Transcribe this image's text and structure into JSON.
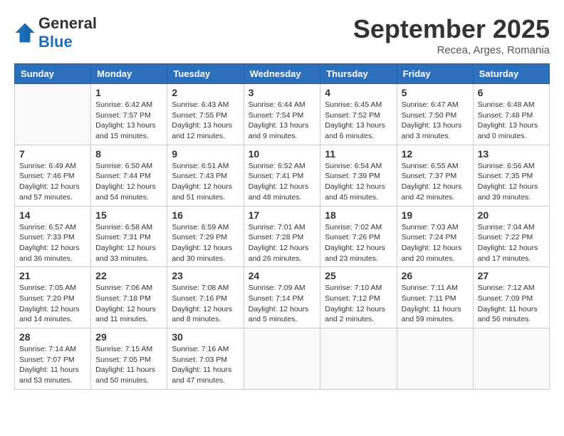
{
  "header": {
    "logo_general": "General",
    "logo_blue": "Blue",
    "month_title": "September 2025",
    "subtitle": "Recea, Arges, Romania"
  },
  "days_of_week": [
    "Sunday",
    "Monday",
    "Tuesday",
    "Wednesday",
    "Thursday",
    "Friday",
    "Saturday"
  ],
  "weeks": [
    [
      {
        "day": "",
        "info": ""
      },
      {
        "day": "1",
        "info": "Sunrise: 6:42 AM\nSunset: 7:57 PM\nDaylight: 13 hours\nand 15 minutes."
      },
      {
        "day": "2",
        "info": "Sunrise: 6:43 AM\nSunset: 7:55 PM\nDaylight: 13 hours\nand 12 minutes."
      },
      {
        "day": "3",
        "info": "Sunrise: 6:44 AM\nSunset: 7:54 PM\nDaylight: 13 hours\nand 9 minutes."
      },
      {
        "day": "4",
        "info": "Sunrise: 6:45 AM\nSunset: 7:52 PM\nDaylight: 13 hours\nand 6 minutes."
      },
      {
        "day": "5",
        "info": "Sunrise: 6:47 AM\nSunset: 7:50 PM\nDaylight: 13 hours\nand 3 minutes."
      },
      {
        "day": "6",
        "info": "Sunrise: 6:48 AM\nSunset: 7:48 PM\nDaylight: 13 hours\nand 0 minutes."
      }
    ],
    [
      {
        "day": "7",
        "info": "Sunrise: 6:49 AM\nSunset: 7:46 PM\nDaylight: 12 hours\nand 57 minutes."
      },
      {
        "day": "8",
        "info": "Sunrise: 6:50 AM\nSunset: 7:44 PM\nDaylight: 12 hours\nand 54 minutes."
      },
      {
        "day": "9",
        "info": "Sunrise: 6:51 AM\nSunset: 7:43 PM\nDaylight: 12 hours\nand 51 minutes."
      },
      {
        "day": "10",
        "info": "Sunrise: 6:52 AM\nSunset: 7:41 PM\nDaylight: 12 hours\nand 48 minutes."
      },
      {
        "day": "11",
        "info": "Sunrise: 6:54 AM\nSunset: 7:39 PM\nDaylight: 12 hours\nand 45 minutes."
      },
      {
        "day": "12",
        "info": "Sunrise: 6:55 AM\nSunset: 7:37 PM\nDaylight: 12 hours\nand 42 minutes."
      },
      {
        "day": "13",
        "info": "Sunrise: 6:56 AM\nSunset: 7:35 PM\nDaylight: 12 hours\nand 39 minutes."
      }
    ],
    [
      {
        "day": "14",
        "info": "Sunrise: 6:57 AM\nSunset: 7:33 PM\nDaylight: 12 hours\nand 36 minutes."
      },
      {
        "day": "15",
        "info": "Sunrise: 6:58 AM\nSunset: 7:31 PM\nDaylight: 12 hours\nand 33 minutes."
      },
      {
        "day": "16",
        "info": "Sunrise: 6:59 AM\nSunset: 7:29 PM\nDaylight: 12 hours\nand 30 minutes."
      },
      {
        "day": "17",
        "info": "Sunrise: 7:01 AM\nSunset: 7:28 PM\nDaylight: 12 hours\nand 26 minutes."
      },
      {
        "day": "18",
        "info": "Sunrise: 7:02 AM\nSunset: 7:26 PM\nDaylight: 12 hours\nand 23 minutes."
      },
      {
        "day": "19",
        "info": "Sunrise: 7:03 AM\nSunset: 7:24 PM\nDaylight: 12 hours\nand 20 minutes."
      },
      {
        "day": "20",
        "info": "Sunrise: 7:04 AM\nSunset: 7:22 PM\nDaylight: 12 hours\nand 17 minutes."
      }
    ],
    [
      {
        "day": "21",
        "info": "Sunrise: 7:05 AM\nSunset: 7:20 PM\nDaylight: 12 hours\nand 14 minutes."
      },
      {
        "day": "22",
        "info": "Sunrise: 7:06 AM\nSunset: 7:18 PM\nDaylight: 12 hours\nand 11 minutes."
      },
      {
        "day": "23",
        "info": "Sunrise: 7:08 AM\nSunset: 7:16 PM\nDaylight: 12 hours\nand 8 minutes."
      },
      {
        "day": "24",
        "info": "Sunrise: 7:09 AM\nSunset: 7:14 PM\nDaylight: 12 hours\nand 5 minutes."
      },
      {
        "day": "25",
        "info": "Sunrise: 7:10 AM\nSunset: 7:12 PM\nDaylight: 12 hours\nand 2 minutes."
      },
      {
        "day": "26",
        "info": "Sunrise: 7:11 AM\nSunset: 7:11 PM\nDaylight: 11 hours\nand 59 minutes."
      },
      {
        "day": "27",
        "info": "Sunrise: 7:12 AM\nSunset: 7:09 PM\nDaylight: 11 hours\nand 56 minutes."
      }
    ],
    [
      {
        "day": "28",
        "info": "Sunrise: 7:14 AM\nSunset: 7:07 PM\nDaylight: 11 hours\nand 53 minutes."
      },
      {
        "day": "29",
        "info": "Sunrise: 7:15 AM\nSunset: 7:05 PM\nDaylight: 11 hours\nand 50 minutes."
      },
      {
        "day": "30",
        "info": "Sunrise: 7:16 AM\nSunset: 7:03 PM\nDaylight: 11 hours\nand 47 minutes."
      },
      {
        "day": "",
        "info": ""
      },
      {
        "day": "",
        "info": ""
      },
      {
        "day": "",
        "info": ""
      },
      {
        "day": "",
        "info": ""
      }
    ]
  ]
}
